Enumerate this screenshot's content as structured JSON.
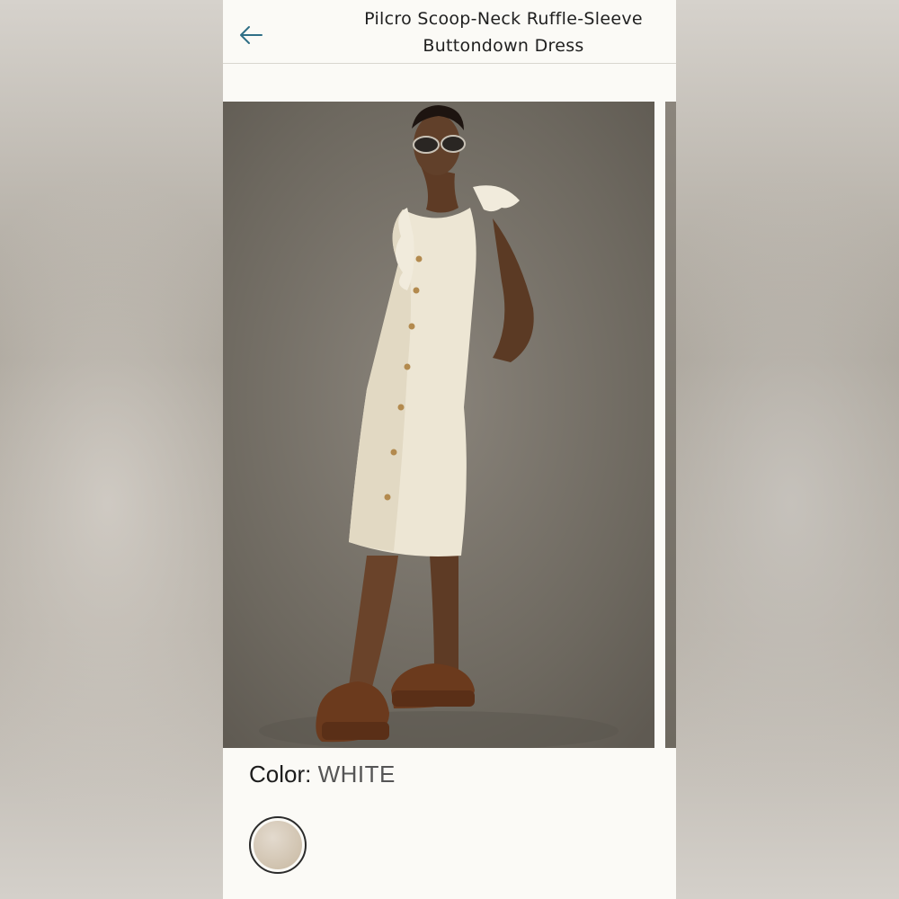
{
  "header": {
    "title_line1": "Pilcro Scoop-Neck Ruffle-Sleeve",
    "title_line2": "Buttondown Dress",
    "back_icon": "arrow-left-icon"
  },
  "product": {
    "color_label": "Color:",
    "color_value": "WHITE",
    "swatch_color": "#d4c7b4"
  },
  "colors": {
    "accent": "#2f6f86",
    "background": "#fbfaf6",
    "text": "#1f1f1f"
  }
}
